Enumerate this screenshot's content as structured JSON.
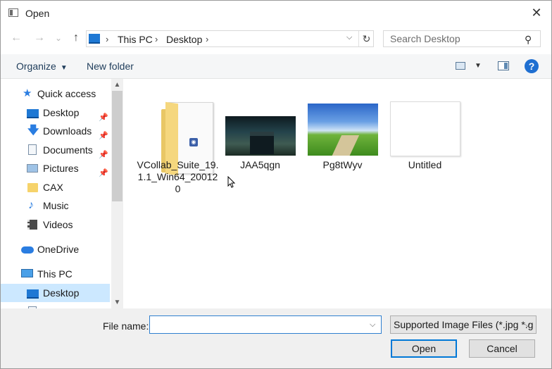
{
  "window": {
    "title": "Open",
    "close_symbol": "✕"
  },
  "nav": {
    "back": "←",
    "forward": "→",
    "recent": "⌄",
    "up": "↑",
    "breadcrumb": [
      "This PC",
      "Desktop"
    ],
    "separator": "›",
    "search_placeholder": "Search Desktop"
  },
  "toolbar": {
    "organize": "Organize",
    "new_folder": "New folder",
    "help": "?"
  },
  "sidebar": {
    "items": [
      {
        "label": "Quick access",
        "icon": "star-icon"
      },
      {
        "label": "Desktop",
        "icon": "desktop-icon",
        "pinned": true
      },
      {
        "label": "Downloads",
        "icon": "download-icon",
        "pinned": true
      },
      {
        "label": "Documents",
        "icon": "documents-icon",
        "pinned": true
      },
      {
        "label": "Pictures",
        "icon": "pictures-icon",
        "pinned": true
      },
      {
        "label": "CAX",
        "icon": "folder-icon"
      },
      {
        "label": "Music",
        "icon": "music-icon"
      },
      {
        "label": "Videos",
        "icon": "videos-icon"
      },
      {
        "label": "OneDrive",
        "icon": "cloud-icon"
      },
      {
        "label": "This PC",
        "icon": "pc-icon"
      },
      {
        "label": "Desktop",
        "icon": "desktop-icon",
        "selected": true
      }
    ]
  },
  "files": [
    {
      "name": "VCollab_Suite_19.1.1_Win64_200120",
      "type": "folder"
    },
    {
      "name": "JAA5qgn",
      "type": "image"
    },
    {
      "name": "Pg8tWyv",
      "type": "image"
    },
    {
      "name": "Untitled",
      "type": "image"
    }
  ],
  "bottom": {
    "file_name_label": "File name:",
    "file_name_value": "",
    "filter": "Supported Image Files (*.jpg *.g",
    "open": "Open",
    "cancel": "Cancel"
  },
  "colors": {
    "accent": "#0078d7",
    "selected": "#cce8ff"
  }
}
